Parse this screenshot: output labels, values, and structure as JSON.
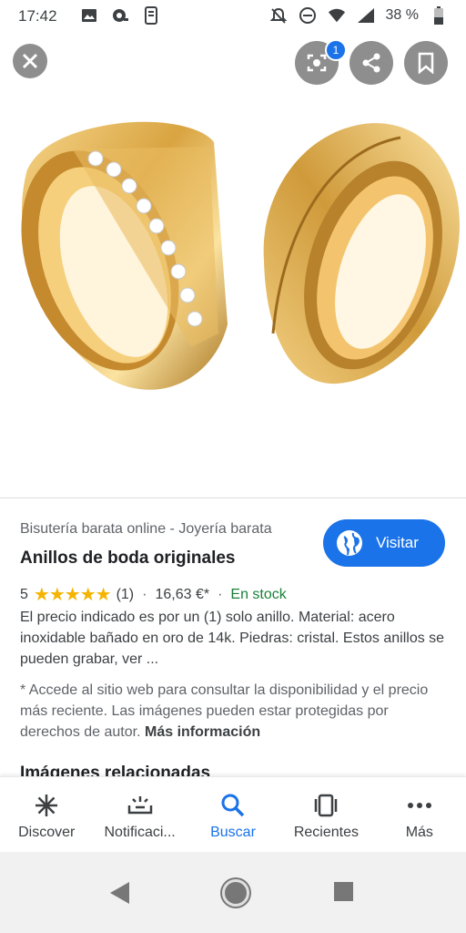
{
  "status_bar": {
    "time": "17:42",
    "battery": "38 %"
  },
  "top_actions": {
    "lens_badge": "1"
  },
  "result": {
    "source": "Bisutería barata online - Joyería barata",
    "title": "Anillos de boda originales",
    "visit_label": "Visitar",
    "rating_value": "5",
    "stars": "★★★★★",
    "review_count": "(1)",
    "price": "16,63 €*",
    "stock": "En stock",
    "description": "El precio indicado es por un (1) solo anillo. Material: acero inoxidable bañado en oro de 14k. Piedras: cristal. Estos anillos se pueden grabar, ver ...",
    "disclaimer": "* Accede al sitio web para consultar la disponibilidad y el precio más reciente. Las imágenes pueden estar protegidas por derechos de autor.",
    "more_info": "Más información",
    "related_heading": "Imágenes relacionadas"
  },
  "bottom_nav": {
    "items": [
      {
        "label": "Discover",
        "icon": "asterisk-icon"
      },
      {
        "label": "Notificaci...",
        "icon": "notifications-icon"
      },
      {
        "label": "Buscar",
        "icon": "search-icon"
      },
      {
        "label": "Recientes",
        "icon": "recents-icon"
      },
      {
        "label": "Más",
        "icon": "more-icon"
      }
    ],
    "active": "Buscar"
  },
  "colors": {
    "accent": "#1a73e8",
    "star": "#f5b400",
    "stock": "#188038",
    "gold": "#d9a441"
  }
}
